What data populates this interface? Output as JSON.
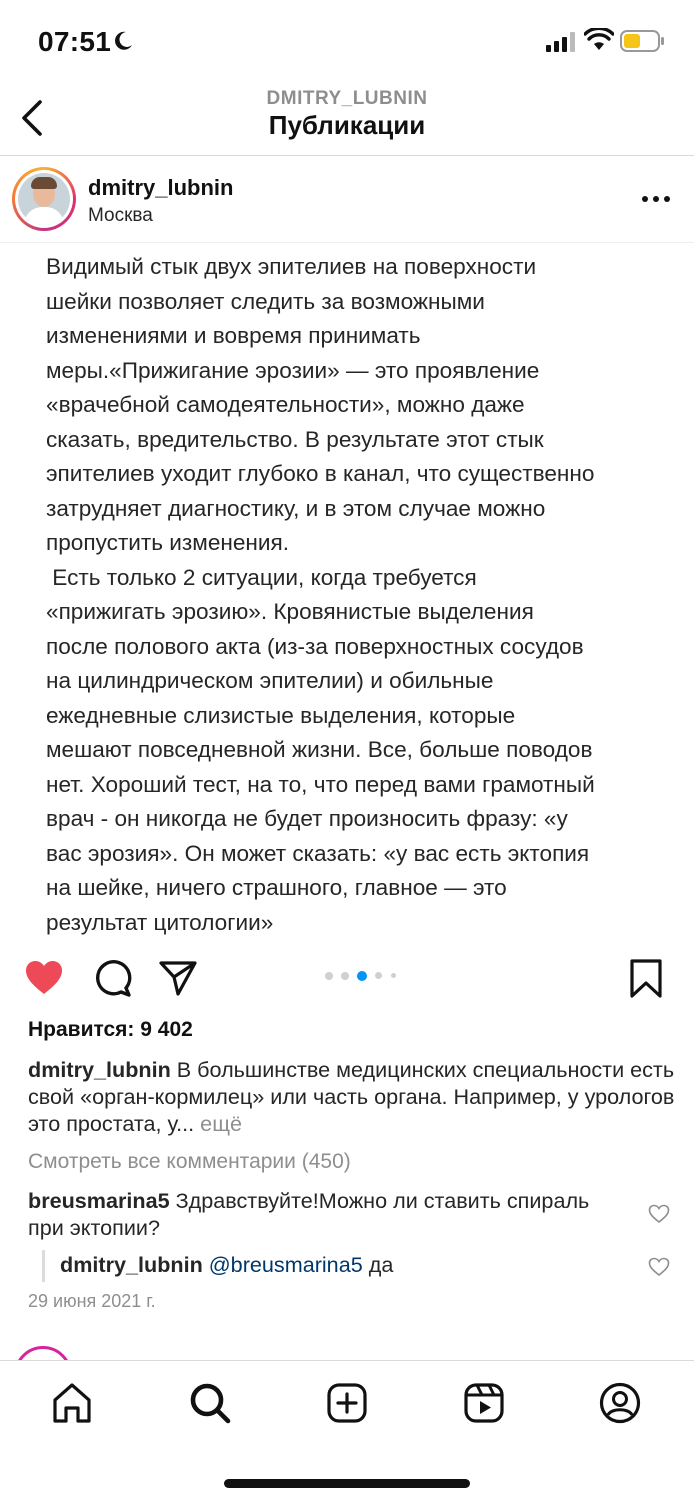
{
  "status_bar": {
    "time": "07:51"
  },
  "header": {
    "subtitle": "DMITRY_LUBNIN",
    "title": "Публикации"
  },
  "post": {
    "username": "dmitry_lubnin",
    "location": "Москва",
    "text": "Видимый стык двух эпителиев на поверхности\nшейки позволяет следить за возможными\nизменениями и вовремя принимать\nмеры.«Прижигание эрозии» — это проявление\n«врачебной самодеятельности», можно даже\nсказать, вредительство. В результате этот стык\nэпителиев уходит глубоко в канал, что существенно\nзатрудняет диагностику, и в этом случае можно\nпропустить изменения.\n Есть только 2 ситуации, когда требуется\n«прижигать эрозию». Кровянистые выделения\nпосле полового акта (из-за поверхностных сосудов\nна цилиндрическом эпителии) и обильные\nежедневные слизистые выделения, которые\nмешают повседневной жизни. Все, больше поводов\nнет. Хороший тест, на то, что перед вами грамотный\nврач - он никогда не будет произносить фразу: «у\nвас эрозия». Он может сказать: «у вас есть эктопия\nна шейке, ничего страшного, главное — это\nрезультат цитологии»",
    "carousel": {
      "total": 5,
      "current": 3
    },
    "likes": "Нравится: 9 402",
    "caption_user": "dmitry_lubnin",
    "caption_text": " В большинстве медицинских специальности есть свой «орган-кормилец» или часть органа. Например, у урологов это простата, у...",
    "caption_more": " ещё",
    "view_all_comments": "Смотреть все комментарии (450)",
    "comment": {
      "user": "breusmarina5",
      "text": " Здравствуйте!Можно ли ставить спираль при эктопии?"
    },
    "reply": {
      "user": "dmitry_lubnin",
      "mention": " @breusmarina5",
      "text": " да"
    },
    "date": "29 июня 2021 г."
  },
  "colors": {
    "like_red": "#ed4956",
    "mention": "#00376b",
    "muted": "#8e8e8e",
    "carousel_active": "#0095f6"
  }
}
